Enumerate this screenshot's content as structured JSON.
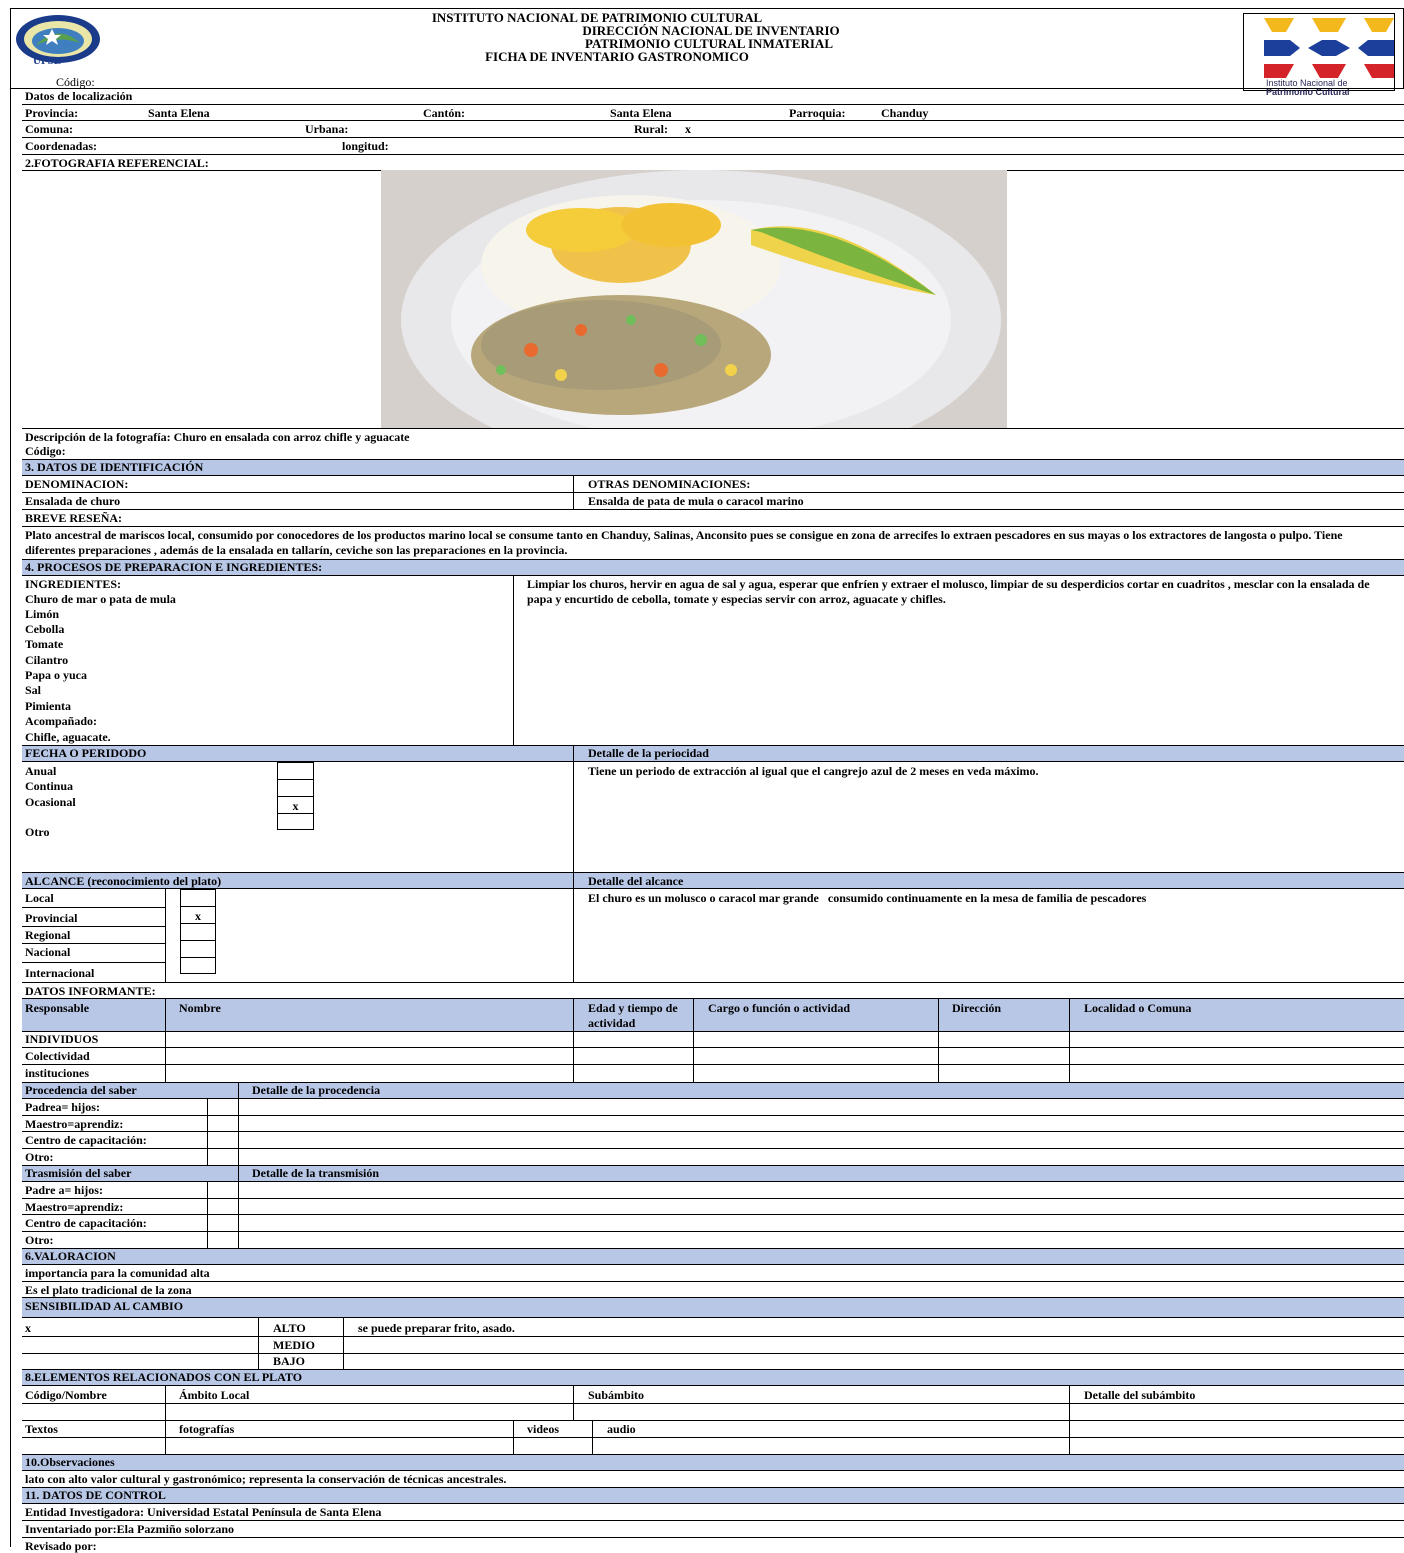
{
  "header": {
    "institute": "INSTITUTO NACIONAL DE PATRIMONIO CULTURAL",
    "direction": "DIRECCIÓN NACIONAL DE INVENTARIO",
    "heritage": "PATRIMONIO CULTURAL INMATERIAL",
    "form": "FICHA DE INVENTARIO GASTRONOMICO",
    "codigo_label": "Código:",
    "left_logo_text": "UPSE",
    "right_logo_small": "Instituto Nacional de",
    "right_logo_bold": "Patrimonio Cultural"
  },
  "localizacion": {
    "title": "Datos de localización",
    "provincia_label": "Provincia:",
    "provincia": "Santa Elena",
    "canton_label": "Cantón:",
    "canton": "Santa Elena",
    "parroquia_label": "Parroquia:",
    "parroquia": "Chanduy",
    "comuna_label": "Comuna:",
    "urbana_label": "Urbana:",
    "rural_label": "Rural:",
    "rural": "x",
    "coordenadas_label": "Coordenadas:",
    "longitud_label": "longitud:"
  },
  "fotografia": {
    "title": "2.FOTOGRAFIA REFERENCIAL:",
    "descripcion": "Descripción de la fotografía: Churo en ensalada con arroz chifle y aguacate",
    "codigo": "Código:"
  },
  "identificacion": {
    "title": "3. DATOS DE IDENTIFICACIÓN",
    "denominacion_label": "DENOMINACION:",
    "otras_label": "OTRAS DENOMINACIONES:",
    "denominacion": "Ensalada de churo",
    "otras": "Ensalda de pata de mula o caracol marino",
    "resena_label": "BREVE RESEÑA:",
    "resena": "Plato ancestral de mariscos local, consumido por conocedores de los productos marino local se consume tanto en Chanduy, Salinas, Anconsito pues se consigue en zona de arrecifes lo extraen pescadores en sus mayas o los extractores de langosta o pulpo. Tiene diferentes preparaciones , además de la ensalada en tallarín, ceviche son las preparaciones en la provincia."
  },
  "procesos": {
    "title": "4. PROCESOS DE PREPARACION E INGREDIENTES:",
    "ingredientes_label": "INGREDIENTES:",
    "ingredientes": [
      "Churo de mar o pata de mula",
      "Limón",
      "Cebolla",
      "Tomate",
      "Cilantro",
      "Papa o yuca",
      "Sal",
      "Pimienta",
      "Acompañado:",
      "Chifle, aguacate."
    ],
    "preparacion": "Limpiar los churos, hervir en agua de sal y agua, esperar que enfríen y extraer el molusco, limpiar de su desperdicios cortar en cuadritos , mesclar con la ensalada de papa y encurtido de cebolla, tomate y especias servir con arroz, aguacate y chifles."
  },
  "fecha": {
    "title": "FECHA O PERIDODO",
    "detalle_title": "Detalle de la periocidad",
    "options": [
      "Anual",
      "Continua",
      "Ocasional",
      "Otro"
    ],
    "marks": [
      "",
      "",
      "x",
      ""
    ],
    "detalle": "Tiene un periodo de extracción al igual que el cangrejo azul de 2 meses en veda máximo."
  },
  "alcance": {
    "title": "ALCANCE (reconocimiento del plato)",
    "detalle_title": "Detalle del alcance",
    "options": [
      "Local",
      "Provincial",
      "Regional",
      "Nacional",
      "Internacional"
    ],
    "marks": [
      "",
      "x",
      "",
      "",
      ""
    ],
    "detalle": "El churo es un molusco o caracol mar grande   consumido continuamente en la mesa de familia de pescadores"
  },
  "informante": {
    "title": "DATOS INFORMANTE:",
    "columns": [
      "Responsable",
      "Nombre",
      "Edad y tiempo de actividad",
      "Cargo o función o actividad",
      "Dirección",
      "Localidad o Comuna"
    ],
    "rows": [
      "INDIVIDUOS",
      "Colectividad",
      "instituciones"
    ]
  },
  "procedencia": {
    "title": "Procedencia del saber",
    "detalle_title": "Detalle de la procedencia",
    "rows": [
      "Padrea= hijos:",
      "Maestro=aprendiz:",
      "Centro de capacitación:",
      "Otro:"
    ]
  },
  "transmision": {
    "title": "Trasmisión del saber",
    "detalle_title": "Detalle de la transmisión",
    "rows": [
      "Padre a= hijos:",
      "Maestro=aprendiz:",
      "Centro de capacitación:",
      "Otro:"
    ]
  },
  "valoracion": {
    "title": "6.VALORACION",
    "line1": "importancia para la comunidad alta",
    "line2": "Es el plato tradicional de la zona"
  },
  "sensibilidad": {
    "title": "SENSIBILIDAD AL CAMBIO",
    "mark": "x",
    "levels": [
      "ALTO",
      "MEDIO",
      "BAJO"
    ],
    "detalle": "se puede preparar frito, asado."
  },
  "elementos": {
    "title": "8.ELEMENTOS RELACIONADOS CON EL PLATO",
    "col1": "Código/Nombre",
    "col2": "Ámbito Local",
    "col3": "Subámbito",
    "col4": "Detalle del subámbito",
    "textos": "Textos",
    "fotografias": "fotografías",
    "videos": "videos",
    "audio": "audio"
  },
  "observaciones": {
    "title": "10.Observaciones",
    "text": "lato con alto valor cultural y gastronómico; representa la conservación de técnicas ancestrales."
  },
  "control": {
    "title": "11. DATOS DE CONTROL",
    "entidad": "Entidad Investigadora: Universidad Estatal Península de Santa Elena",
    "inventariado": "Inventariado por:Ela Pazmiño solorzano",
    "revisado": "Revisado por:"
  }
}
